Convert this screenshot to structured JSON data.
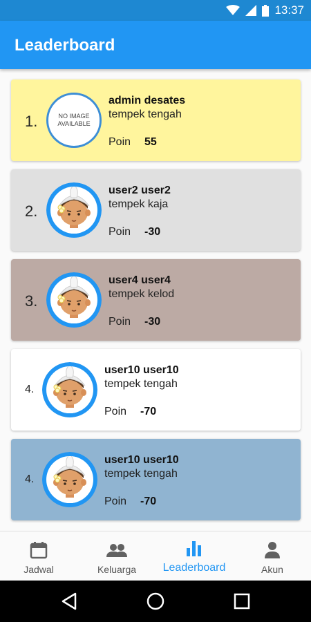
{
  "status_bar": {
    "time": "13:37"
  },
  "app_bar": {
    "title": "Leaderboard"
  },
  "leaderboard": [
    {
      "rank": "1.",
      "name": "admin desates",
      "group": "tempek tengah",
      "poin_label": "Poin",
      "poin": "55",
      "avatar_text": "NO IMAGE AVAILABLE",
      "bg": "#fff59d"
    },
    {
      "rank": "2.",
      "name": "user2 user2",
      "group": "tempek kaja",
      "poin_label": "Poin",
      "poin": "-30",
      "bg": "#e0e0e0"
    },
    {
      "rank": "3.",
      "name": "user4 user4",
      "group": "tempek kelod",
      "poin_label": "Poin",
      "poin": "-30",
      "bg": "#bcaaa4"
    },
    {
      "rank": "4.",
      "name": "user10 user10",
      "group": "tempek tengah",
      "poin_label": "Poin",
      "poin": "-70",
      "bg": "#ffffff"
    },
    {
      "rank": "4.",
      "name": "user10 user10",
      "group": "tempek tengah",
      "poin_label": "Poin",
      "poin": "-70",
      "bg": "#90b4d1"
    }
  ],
  "bottom_nav": {
    "items": [
      {
        "label": "Jadwal",
        "icon": "calendar-icon"
      },
      {
        "label": "Keluarga",
        "icon": "people-icon"
      },
      {
        "label": "Leaderboard",
        "icon": "bar-chart-icon",
        "active": true
      },
      {
        "label": "Akun",
        "icon": "person-icon"
      }
    ]
  },
  "colors": {
    "primary": "#2196f3",
    "status_bar": "#1e88d2",
    "active_nav": "#2196f3"
  }
}
